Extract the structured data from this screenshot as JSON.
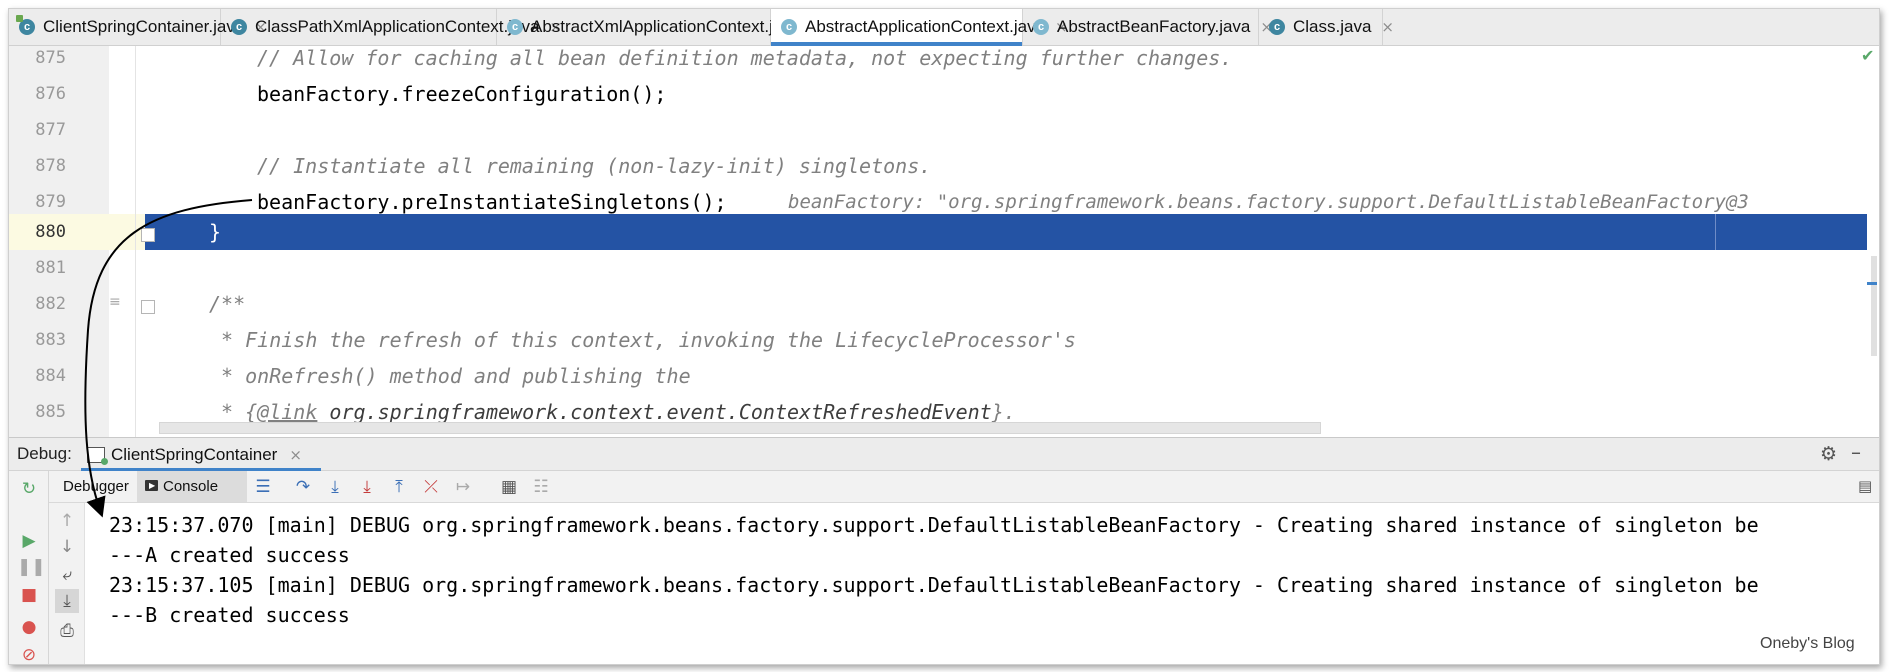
{
  "tabs": [
    {
      "label": "ClientSpringContainer.java",
      "icon": "class-icon",
      "active": false
    },
    {
      "label": "ClassPathXmlApplicationContext.java",
      "icon": "class-icon",
      "active": false
    },
    {
      "label": "AbstractXmlApplicationContext.java",
      "icon": "abstract-class-icon",
      "active": false
    },
    {
      "label": "AbstractApplicationContext.java",
      "icon": "abstract-class-icon",
      "active": true
    },
    {
      "label": "AbstractBeanFactory.java",
      "icon": "abstract-class-icon",
      "active": false
    },
    {
      "label": "Class.java",
      "icon": "class-icon",
      "active": false
    }
  ],
  "tab_close_glyph": "×",
  "editor": {
    "line_numbers": [
      "875",
      "876",
      "877",
      "878",
      "879",
      "880",
      "881",
      "882",
      "883",
      "884",
      "885"
    ],
    "lines": {
      "l875": "// Allow for caching all bean definition metadata, not expecting further changes.",
      "l876": "beanFactory.freezeConfiguration();",
      "l878": "// Instantiate all remaining (non-lazy-init) singletons.",
      "l879": "beanFactory.preInstantiateSingletons();",
      "l879_inline": "beanFactory: \"org.springframework.beans.factory.support.DefaultListableBeanFactory@3",
      "l880": "}",
      "l882": "/**",
      "l883": " * Finish the refresh of this context, invoking the LifecycleProcessor's",
      "l884": " * onRefresh() method and publishing the",
      "l885_prefix": " * {",
      "l885_tag": "@link",
      "l885_ref": " org.springframework.context.event.ContextRefreshedEvent",
      "l885_suffix": "}."
    }
  },
  "debug": {
    "label": "Debug:",
    "session": "ClientSpringContainer",
    "tabs": {
      "debugger": "Debugger",
      "console": "Console"
    }
  },
  "console": {
    "lines": [
      "23:15:37.070 [main] DEBUG org.springframework.beans.factory.support.DefaultListableBeanFactory - Creating shared instance of singleton be",
      "---A created success",
      "23:15:37.105 [main] DEBUG org.springframework.beans.factory.support.DefaultListableBeanFactory - Creating shared instance of singleton be",
      "---B created success"
    ]
  },
  "watermark": "Oneby's Blog",
  "colors": {
    "selection": "#2453a4",
    "accent": "#4083c9",
    "comment": "#808080"
  }
}
